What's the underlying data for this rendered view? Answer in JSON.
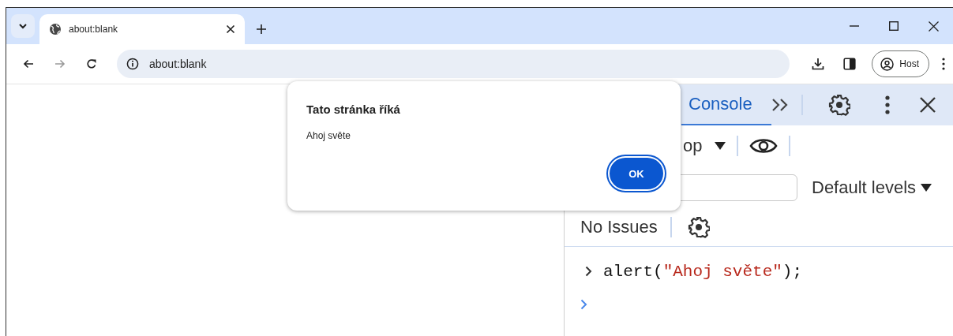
{
  "browser": {
    "tabs": [
      {
        "title": "about:blank",
        "selected": true
      }
    ],
    "address": "about:blank",
    "profile": "Host"
  },
  "devtools": {
    "tabs": [
      {
        "label": "Console",
        "selected": true
      }
    ],
    "context": "op",
    "levels": "Default levels",
    "issues": "No Issues",
    "console": [
      {
        "kind": "command",
        "tokens": [
          {
            "kind": "code",
            "text": "alert("
          },
          {
            "kind": "string",
            "text": "\"Ahoj světe\""
          },
          {
            "kind": "code",
            "text": ");"
          }
        ]
      },
      {
        "kind": "prompt"
      }
    ]
  },
  "dialog": {
    "title": "Tato stránka říká",
    "message": "Ahoj světe",
    "buttons": [
      {
        "label": "OK",
        "focused": true
      }
    ]
  }
}
